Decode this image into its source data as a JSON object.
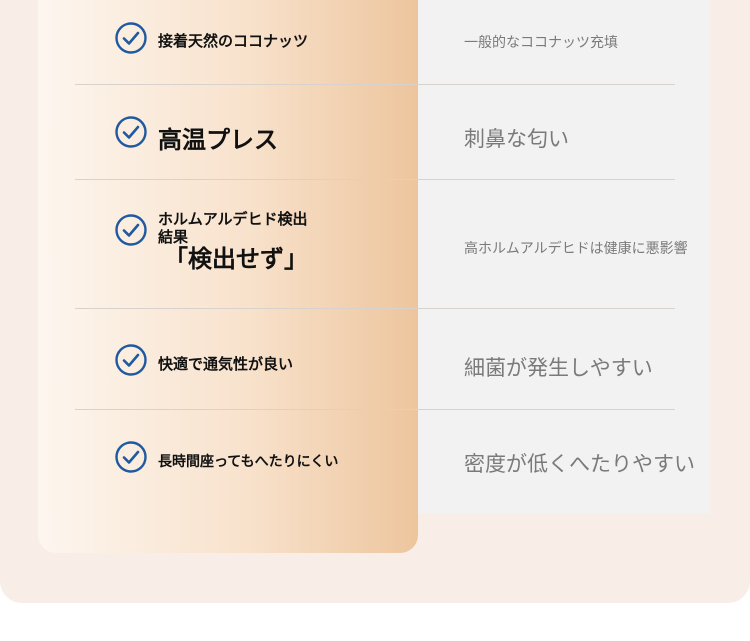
{
  "rows": [
    {
      "feature": "接着天然のココナッツ",
      "drawback": "一般的なココナッツ充填"
    },
    {
      "feature": "高温プレス",
      "drawback": "刺鼻な匂い"
    },
    {
      "feature_line1": "ホルムアルデヒド検出",
      "feature_line2": "結果",
      "feature_line3": "「検出せず」",
      "drawback": "高ホルムアルデヒドは健康に悪影響"
    },
    {
      "feature": "快適で通気性が良い",
      "drawback": "細菌が発生しやすい"
    },
    {
      "feature": "長時間座ってもへたりにくい",
      "drawback": "密度が低くへたりやすい"
    }
  ],
  "colors": {
    "check": "#1f5aa0",
    "outer_bg": "#f8ede7",
    "panel_right": "#f2f2f2",
    "gradient_end": "#edc59d"
  },
  "icons": {
    "check": "check-circle-icon"
  }
}
